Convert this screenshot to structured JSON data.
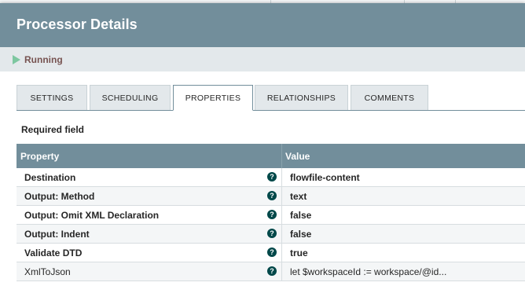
{
  "dialog": {
    "title": "Processor Details",
    "status": "Running"
  },
  "tabs": [
    {
      "label": "SETTINGS"
    },
    {
      "label": "SCHEDULING"
    },
    {
      "label": "PROPERTIES",
      "active": true
    },
    {
      "label": "RELATIONSHIPS"
    },
    {
      "label": "COMMENTS"
    }
  ],
  "properties": {
    "required_label": "Required field",
    "header": {
      "property": "Property",
      "value": "Value"
    },
    "help_glyph": "?",
    "rows": [
      {
        "name": "Destination",
        "value": "flowfile-content",
        "required": true
      },
      {
        "name": "Output: Method",
        "value": "text",
        "required": true
      },
      {
        "name": "Output: Omit XML Declaration",
        "value": "false",
        "required": true
      },
      {
        "name": "Output: Indent",
        "value": "false",
        "required": true
      },
      {
        "name": "Validate DTD",
        "value": "true",
        "required": true
      },
      {
        "name": "XmlToJson",
        "value": "let $workspaceId := workspace/@id...",
        "required": false
      }
    ]
  },
  "colors": {
    "header_bg": "#728e9b",
    "status_bg": "#e3e8eb",
    "running_icon": "#7dc7a0",
    "status_text": "#775351",
    "help_icon": "#004849"
  }
}
